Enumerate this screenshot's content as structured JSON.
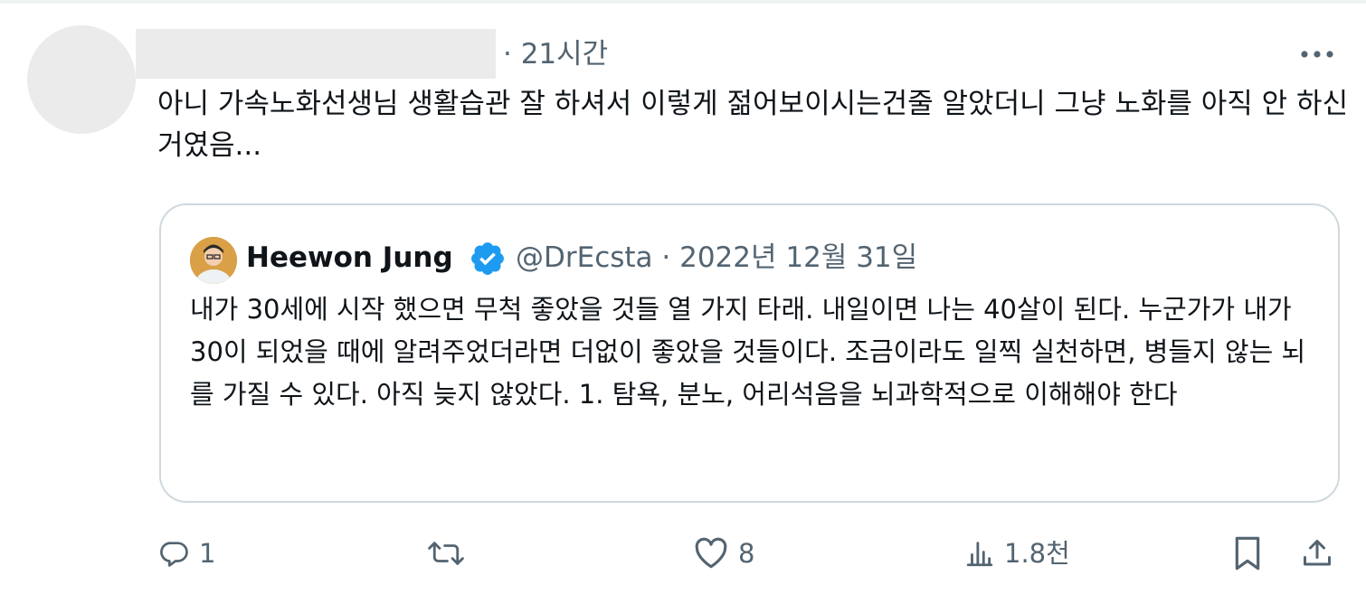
{
  "tweet": {
    "timestamp": "· 21시간",
    "text": "아니 가속노화선생님 생활습관 잘 하셔서 이렇게 젊어보이시는건줄 알았더니 그냥 노화를 아직 안 하신 거였음..."
  },
  "quote": {
    "display_name": "Heewon Jung",
    "handle_and_date": "@DrEcsta · 2022년 12월 31일",
    "text": "내가 30세에 시작 했으면 무척 좋았을 것들 열 가지 타래. 내일이면 나는 40살이 된다. 누군가가 내가 30이 되었을 때에 알려주었더라면 더없이 좋았을 것들이다. 조금이라도 일찍 실천하면, 병들지 않는 뇌를 가질 수 있다. 아직 늦지 않았다.  1. 탐욕, 분노, 어리석음을 뇌과학적으로 이해해야 한다"
  },
  "actions": {
    "reply_count": "1",
    "retweet_count": "",
    "like_count": "8",
    "views_count": "1.8천"
  },
  "icons": {
    "more": "more-icon",
    "verified": "verified-badge-icon",
    "reply": "reply-icon",
    "retweet": "retweet-icon",
    "like": "heart-icon",
    "views": "views-icon",
    "bookmark": "bookmark-icon",
    "share": "share-icon"
  },
  "colors": {
    "verified_blue": "#1d9bf0",
    "secondary_text": "#536471",
    "border": "#cfd9de"
  }
}
